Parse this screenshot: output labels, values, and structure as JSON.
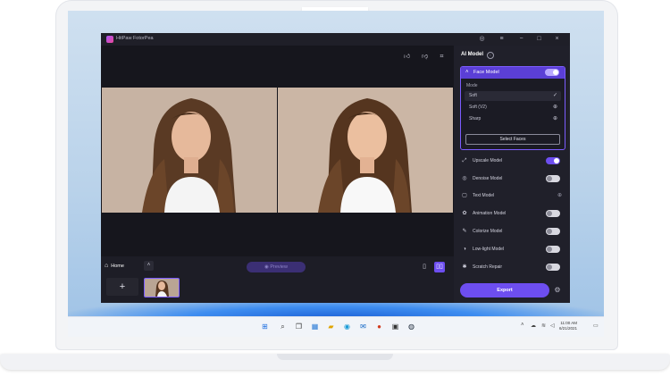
{
  "app": {
    "title": "HitPaw FotorPea",
    "window_controls": [
      "user-icon",
      "menu-icon",
      "minimize-icon",
      "maximize-icon",
      "close-icon"
    ]
  },
  "canvas": {
    "tools": [
      "thumbs-up-icon",
      "thumbs-down-icon",
      "crop-icon"
    ],
    "zoom": [
      "+",
      "−"
    ]
  },
  "bottom": {
    "home_label": "Home",
    "preview_label": "Preview",
    "add_label": "+"
  },
  "panel": {
    "title": "AI Model",
    "face_model": {
      "label": "Face Model",
      "enabled": true,
      "mode_label": "Mode",
      "modes": [
        {
          "name": "Soft",
          "mark": "✓"
        },
        {
          "name": "Soft (V2)",
          "mark": "⊕"
        },
        {
          "name": "Sharp",
          "mark": "⊕"
        }
      ],
      "select_faces_label": "Select Faces"
    },
    "models": [
      {
        "name": "Upscale Model",
        "icon": "upscale-icon",
        "enabled": true
      },
      {
        "name": "Denoise Model",
        "icon": "denoise-icon",
        "enabled": false
      },
      {
        "name": "Text Model",
        "icon": "text-icon",
        "enabled": null
      },
      {
        "name": "Animation Model",
        "icon": "animation-icon",
        "enabled": false
      },
      {
        "name": "Colorize Model",
        "icon": "colorize-icon",
        "enabled": false
      },
      {
        "name": "Low-light Model",
        "icon": "low-light-icon",
        "enabled": false
      },
      {
        "name": "Scratch Repair",
        "icon": "scratch-icon",
        "enabled": false
      }
    ],
    "export_label": "Export"
  },
  "taskbar": {
    "apps": [
      "start-icon",
      "search-icon",
      "task-view-icon",
      "widgets-icon",
      "file-explorer-icon",
      "edge-icon",
      "mail-icon",
      "office-icon",
      "store-icon",
      "steam-icon"
    ],
    "time": "11:00 AM",
    "date": "6/21/2021"
  },
  "colors": {
    "accent": "#6d4ef0",
    "panel_bg": "#20202a",
    "app_bg": "#1a1a22"
  }
}
